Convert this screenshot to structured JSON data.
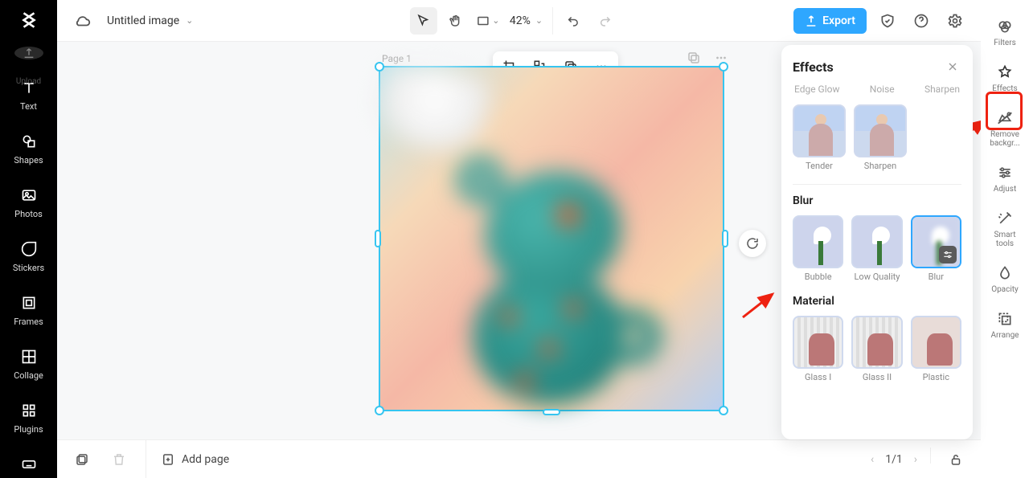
{
  "header": {
    "title": "Untitled image",
    "zoom": "42%",
    "export_label": "Export"
  },
  "left_rail": {
    "upload_label": "Upload",
    "items": [
      {
        "label": "Text",
        "icon": "text-icon"
      },
      {
        "label": "Shapes",
        "icon": "shapes-icon"
      },
      {
        "label": "Photos",
        "icon": "photos-icon"
      },
      {
        "label": "Stickers",
        "icon": "stickers-icon"
      },
      {
        "label": "Frames",
        "icon": "frames-icon"
      },
      {
        "label": "Collage",
        "icon": "collage-icon"
      },
      {
        "label": "Plugins",
        "icon": "plugins-icon"
      }
    ]
  },
  "right_rail": {
    "items": [
      {
        "label": "Filters",
        "icon": "filters-icon"
      },
      {
        "label": "Effects",
        "icon": "effects-icon"
      },
      {
        "label": "Remove backgr...",
        "icon": "remove-bg-icon"
      },
      {
        "label": "Adjust",
        "icon": "adjust-icon"
      },
      {
        "label": "Smart tools",
        "icon": "smart-tools-icon"
      },
      {
        "label": "Opacity",
        "icon": "opacity-icon"
      },
      {
        "label": "Arrange",
        "icon": "arrange-icon"
      }
    ]
  },
  "canvas": {
    "page_label": "Page 1"
  },
  "bottombar": {
    "add_page_label": "Add page",
    "page_indicator": "1/1"
  },
  "effects_panel": {
    "title": "Effects",
    "tabs": [
      "Edge Glow",
      "Noise",
      "Sharpen"
    ],
    "row1": [
      "Tender",
      "Sharpen"
    ],
    "section_blur": "Blur",
    "row_blur": [
      "Bubble",
      "Low Quality",
      "Blur"
    ],
    "selected_blur_index": 2,
    "section_material": "Material",
    "row_material": [
      "Glass I",
      "Glass II",
      "Plastic"
    ]
  },
  "annotation": {
    "highlighted_right_rail_index": 1
  }
}
